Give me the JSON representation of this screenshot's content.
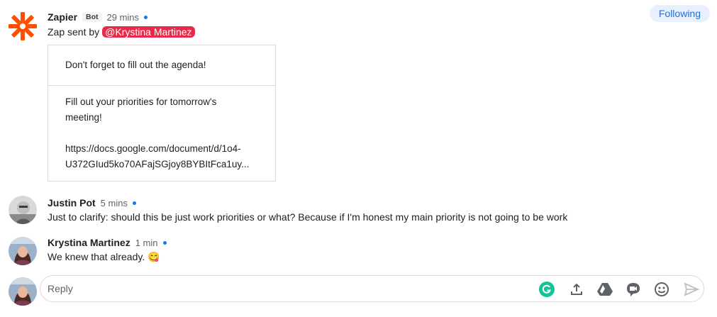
{
  "header": {
    "following_label": "Following"
  },
  "zapier_message": {
    "sender": "Zapier",
    "badge": "Bot",
    "time": "29 mins",
    "intro": "Zap sent by",
    "mention": "@Krystina Martinez",
    "card": {
      "line1": "Don't forget to fill out the agenda!",
      "line2a": "Fill out your priorities for tomorrow's",
      "line2b": "meeting!",
      "link_a": "https://docs.google.com/document/d/1o4-",
      "link_b": "U372GIud5ko70AFajSGjoy8BYBItFca1uy..."
    }
  },
  "messages": [
    {
      "sender": "Justin Pot",
      "time": "5 mins",
      "text": "Just to clarify: should this be just work priorities or what? Because if I'm honest my main priority is not going to be work"
    },
    {
      "sender": "Krystina Martinez",
      "time": "1 min",
      "text": "We knew that already. 😋"
    }
  ],
  "reply": {
    "placeholder": "Reply"
  },
  "colors": {
    "accent": "#1a73e8",
    "mention": "#e8294a",
    "zapier": "#ff4f00",
    "grammarly": "#15c39a"
  },
  "icons": [
    "zapier-logo-icon",
    "grammarly-icon",
    "upload-icon",
    "google-drive-icon",
    "video-meet-icon",
    "emoji-icon",
    "send-icon"
  ]
}
